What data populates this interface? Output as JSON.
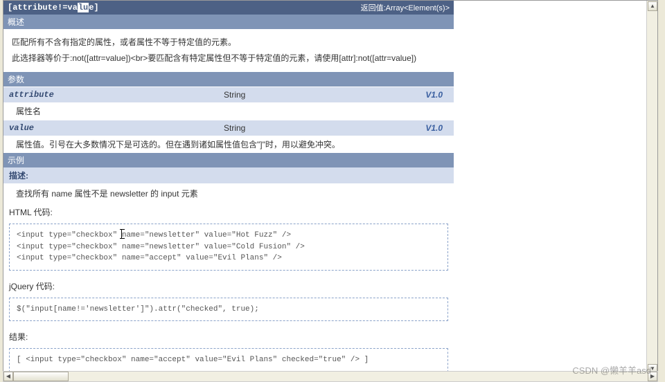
{
  "title": {
    "selector_prefix": "[attribute!=va",
    "selector_highlight": "lu",
    "selector_suffix": "e]",
    "return_label": "返回值:Array<Element(s)>"
  },
  "sections": {
    "overview_head": "概述",
    "overview_p1": "匹配所有不含有指定的属性，或者属性不等于特定值的元素。",
    "overview_p2": "此选择器等价于:not([attr=value])<br>要匹配含有特定属性但不等于特定值的元素，请使用[attr]:not([attr=value])",
    "params_head": "参数",
    "params": [
      {
        "name": "attribute",
        "type": "String",
        "ver": "V1.0",
        "desc": "属性名"
      },
      {
        "name": "value",
        "type": "String",
        "ver": "V1.0",
        "desc": "属性值。引号在大多数情况下是可选的。但在遇到诸如属性值包含\"]\"时，用以避免冲突。"
      }
    ],
    "example_head": "示例",
    "example_desc_label": "描述:",
    "example_desc": "查找所有 name 属性不是 newsletter 的 input 元素",
    "html_label": "HTML 代码:",
    "html_code": "<input type=\"checkbox\" name=\"newsletter\" value=\"Hot Fuzz\" />\n<input type=\"checkbox\" name=\"newsletter\" value=\"Cold Fusion\" />\n<input type=\"checkbox\" name=\"accept\" value=\"Evil Plans\" />",
    "jquery_label": "jQuery 代码:",
    "jquery_code": "$(\"input[name!='newsletter']\").attr(\"checked\", true);",
    "result_label": "结果:",
    "result_code": "[ <input type=\"checkbox\" name=\"accept\" value=\"Evil Plans\" checked=\"true\" /> ]"
  },
  "watermark": "CSDN @懒羊羊asd"
}
